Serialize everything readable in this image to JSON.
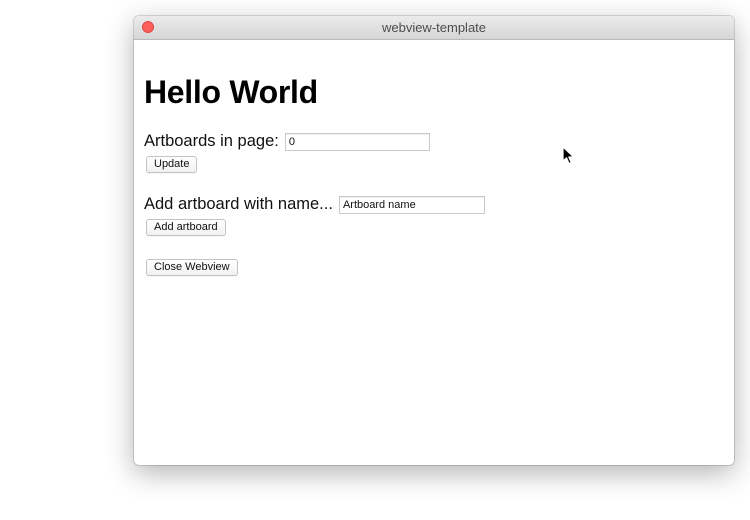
{
  "window": {
    "title": "webview-template"
  },
  "main": {
    "heading": "Hello World",
    "artboards_label": "Artboards in page:",
    "artboards_value": "0",
    "update_button": "Update",
    "add_label": "Add artboard with name...",
    "add_value": "Artboard name",
    "add_button": "Add artboard",
    "close_button": "Close Webview"
  },
  "colors": {
    "close_light": "#fc605c",
    "titlebar_top": "#ebebeb",
    "titlebar_bottom": "#d6d6d6",
    "text": "#000000"
  },
  "icons": {
    "window_close": "close-traffic-light",
    "pointer": "mouse-pointer-icon"
  }
}
